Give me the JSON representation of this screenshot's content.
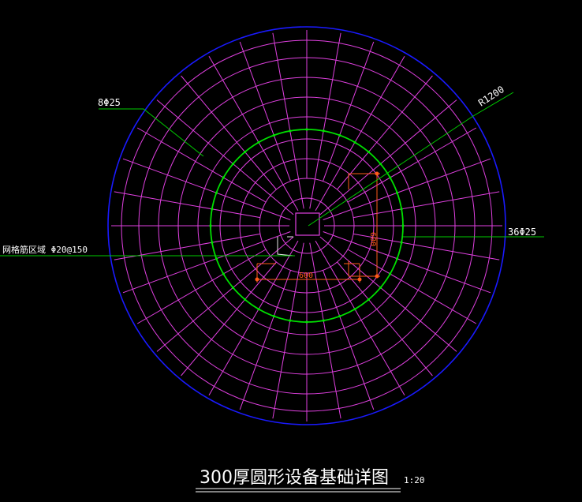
{
  "drawing": {
    "title": "300厚圆形设备基础详图",
    "scale": "1:20"
  },
  "annotations": {
    "top_left_rebar": "8Φ25",
    "radius": "R1200",
    "right_rebar": "36Φ25",
    "left_mesh": "网格筋区域 Φ20@150",
    "dim_horizontal": "600",
    "dim_vertical": "600"
  },
  "colors": {
    "background": "#000000",
    "outer_circle": "#1a1aff",
    "mesh": "#e040e0",
    "ring_bar": "#00e000",
    "leader": "#00cc00",
    "dimension": "#ff5a1a",
    "text": "#ffffff"
  }
}
